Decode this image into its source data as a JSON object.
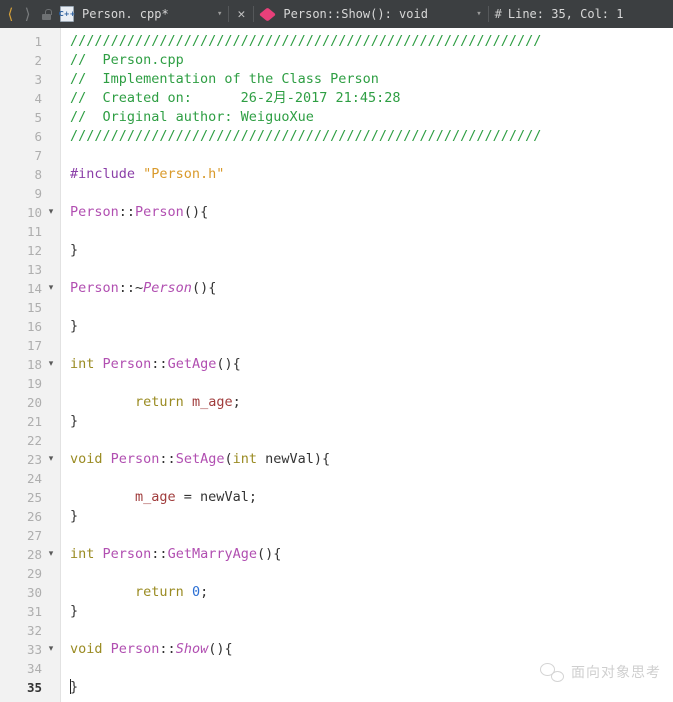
{
  "toolbar": {
    "back_icon": "chevron-left-icon",
    "forward_icon": "chevron-right-icon",
    "lock_icon": "lock-icon",
    "file_icon_label": "C++",
    "file_name": "Person. cpp*",
    "file_caret": "▾",
    "close_label": "✕",
    "symbol_marker_icon": "method-diamond-icon",
    "symbol_name": "Person::Show(): void",
    "symbol_caret": "▾",
    "hash_label": "#",
    "line_col": "Line: 35, Col: 1",
    "edge_label": " "
  },
  "editor": {
    "lines": [
      {
        "n": "1",
        "fold": "",
        "segments": [
          {
            "t": "//////////////////////////////////////////////////////////",
            "c": "cmt"
          }
        ]
      },
      {
        "n": "2",
        "fold": "",
        "segments": [
          {
            "t": "//  Person.cpp",
            "c": "cmt"
          }
        ]
      },
      {
        "n": "3",
        "fold": "",
        "segments": [
          {
            "t": "//  Implementation of the Class Person",
            "c": "cmt"
          }
        ]
      },
      {
        "n": "4",
        "fold": "",
        "segments": [
          {
            "t": "//  Created on:      26-2月-2017 21:45:28",
            "c": "cmt"
          }
        ]
      },
      {
        "n": "5",
        "fold": "",
        "segments": [
          {
            "t": "//  Original author: WeiguoXue",
            "c": "cmt"
          }
        ]
      },
      {
        "n": "6",
        "fold": "",
        "segments": [
          {
            "t": "//////////////////////////////////////////////////////////",
            "c": "cmt"
          }
        ]
      },
      {
        "n": "7",
        "fold": "",
        "segments": []
      },
      {
        "n": "8",
        "fold": "",
        "segments": [
          {
            "t": "#include ",
            "c": "pre"
          },
          {
            "t": "\"Person.h\"",
            "c": "str"
          }
        ]
      },
      {
        "n": "9",
        "fold": "",
        "segments": []
      },
      {
        "n": "10",
        "fold": "▾",
        "segments": [
          {
            "t": "Person",
            "c": "cls"
          },
          {
            "t": "::",
            "c": "pl"
          },
          {
            "t": "Person",
            "c": "cls"
          },
          {
            "t": "(){",
            "c": "pl"
          }
        ]
      },
      {
        "n": "11",
        "fold": "",
        "segments": []
      },
      {
        "n": "12",
        "fold": "",
        "segments": [
          {
            "t": "}",
            "c": "pl"
          }
        ]
      },
      {
        "n": "13",
        "fold": "",
        "segments": []
      },
      {
        "n": "14",
        "fold": "▾",
        "segments": [
          {
            "t": "Person",
            "c": "cls"
          },
          {
            "t": "::~",
            "c": "pl"
          },
          {
            "t": "Person",
            "c": "clsI"
          },
          {
            "t": "(){",
            "c": "pl"
          }
        ]
      },
      {
        "n": "15",
        "fold": "",
        "segments": []
      },
      {
        "n": "16",
        "fold": "",
        "segments": [
          {
            "t": "}",
            "c": "pl"
          }
        ]
      },
      {
        "n": "17",
        "fold": "",
        "segments": []
      },
      {
        "n": "18",
        "fold": "▾",
        "segments": [
          {
            "t": "int ",
            "c": "kw"
          },
          {
            "t": "Person",
            "c": "cls"
          },
          {
            "t": "::",
            "c": "pl"
          },
          {
            "t": "GetAge",
            "c": "cls"
          },
          {
            "t": "(){",
            "c": "pl"
          }
        ]
      },
      {
        "n": "19",
        "fold": "",
        "segments": []
      },
      {
        "n": "20",
        "fold": "",
        "segments": [
          {
            "t": "        ",
            "c": "pl"
          },
          {
            "t": "return ",
            "c": "kw"
          },
          {
            "t": "m_age",
            "c": "mem"
          },
          {
            "t": ";",
            "c": "pl"
          }
        ]
      },
      {
        "n": "21",
        "fold": "",
        "segments": [
          {
            "t": "}",
            "c": "pl"
          }
        ]
      },
      {
        "n": "22",
        "fold": "",
        "segments": []
      },
      {
        "n": "23",
        "fold": "▾",
        "segments": [
          {
            "t": "void ",
            "c": "kw"
          },
          {
            "t": "Person",
            "c": "cls"
          },
          {
            "t": "::",
            "c": "pl"
          },
          {
            "t": "SetAge",
            "c": "cls"
          },
          {
            "t": "(",
            "c": "pl"
          },
          {
            "t": "int",
            "c": "kw"
          },
          {
            "t": " newVal){",
            "c": "pl"
          }
        ]
      },
      {
        "n": "24",
        "fold": "",
        "segments": []
      },
      {
        "n": "25",
        "fold": "",
        "segments": [
          {
            "t": "        ",
            "c": "pl"
          },
          {
            "t": "m_age",
            "c": "mem"
          },
          {
            "t": " = newVal;",
            "c": "pl"
          }
        ]
      },
      {
        "n": "26",
        "fold": "",
        "segments": [
          {
            "t": "}",
            "c": "pl"
          }
        ]
      },
      {
        "n": "27",
        "fold": "",
        "segments": []
      },
      {
        "n": "28",
        "fold": "▾",
        "segments": [
          {
            "t": "int ",
            "c": "kw"
          },
          {
            "t": "Person",
            "c": "cls"
          },
          {
            "t": "::",
            "c": "pl"
          },
          {
            "t": "GetMarryAge",
            "c": "cls"
          },
          {
            "t": "(){",
            "c": "pl"
          }
        ]
      },
      {
        "n": "29",
        "fold": "",
        "segments": []
      },
      {
        "n": "30",
        "fold": "",
        "segments": [
          {
            "t": "        ",
            "c": "pl"
          },
          {
            "t": "return ",
            "c": "kw"
          },
          {
            "t": "0",
            "c": "num"
          },
          {
            "t": ";",
            "c": "pl"
          }
        ]
      },
      {
        "n": "31",
        "fold": "",
        "segments": [
          {
            "t": "}",
            "c": "pl"
          }
        ]
      },
      {
        "n": "32",
        "fold": "",
        "segments": []
      },
      {
        "n": "33",
        "fold": "▾",
        "segments": [
          {
            "t": "void ",
            "c": "kw"
          },
          {
            "t": "Person",
            "c": "cls"
          },
          {
            "t": "::",
            "c": "pl"
          },
          {
            "t": "Show",
            "c": "clsI"
          },
          {
            "t": "(){",
            "c": "pl"
          }
        ]
      },
      {
        "n": "34",
        "fold": "",
        "segments": []
      },
      {
        "n": "35",
        "fold": "",
        "current": true,
        "caret": true,
        "segments": [
          {
            "t": "}",
            "c": "pl"
          }
        ]
      }
    ]
  },
  "watermark": {
    "logo_icon": "wechat-logo-icon",
    "text": "面向对象思考"
  }
}
